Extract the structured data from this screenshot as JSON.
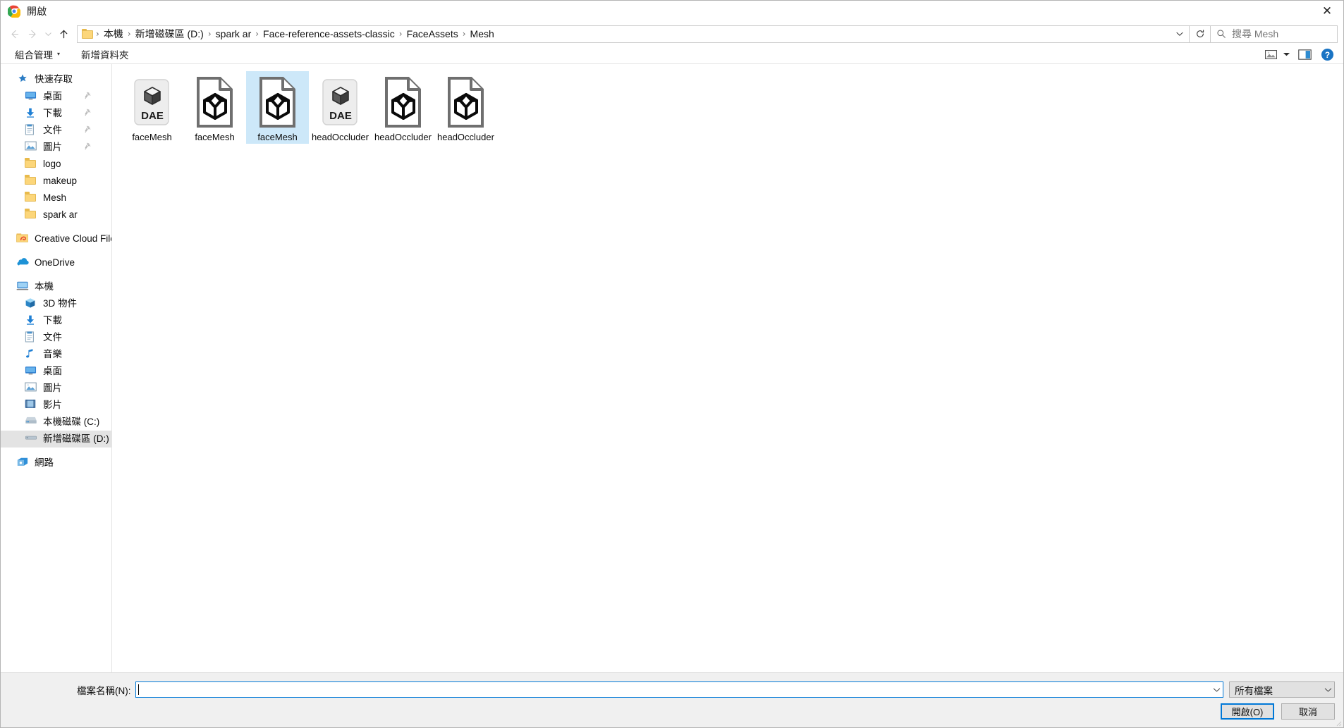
{
  "titlebar": {
    "app_icon": "chrome-icon",
    "title": "開啟",
    "close_label": "✕"
  },
  "navbar": {
    "back_icon": "arrow-left-icon",
    "forward_icon": "arrow-right-icon",
    "recent_icon": "chevron-down-icon",
    "up_icon": "arrow-up-icon",
    "breadcrumb": [
      "本機",
      "新增磁碟區 (D:)",
      "spark ar",
      "Face-reference-assets-classic",
      "FaceAssets",
      "Mesh"
    ],
    "separator": "›",
    "address_dropdown_icon": "chevron-down-icon",
    "refresh_icon": "refresh-icon",
    "search": {
      "icon": "search-icon",
      "placeholder": "搜尋 Mesh",
      "value": ""
    }
  },
  "toolbar": {
    "organize_label": "組合管理",
    "organize_caret": "▾",
    "new_folder_label": "新增資料夾",
    "view_icon": "view-layout-icon",
    "view_caret": "▾",
    "preview_pane_icon": "preview-pane-icon",
    "help_icon": "help-icon"
  },
  "sidebar": {
    "groups": [
      {
        "name": "quick-access",
        "header": {
          "label": "快速存取",
          "icon": "star-pin-icon"
        },
        "items": [
          {
            "label": "桌面",
            "icon": "desktop-icon",
            "pinned": true
          },
          {
            "label": "下載",
            "icon": "downloads-icon",
            "pinned": true
          },
          {
            "label": "文件",
            "icon": "documents-icon",
            "pinned": true
          },
          {
            "label": "圖片",
            "icon": "pictures-icon",
            "pinned": true
          },
          {
            "label": "logo",
            "icon": "folder-icon",
            "pinned": false
          },
          {
            "label": "makeup",
            "icon": "folder-icon",
            "pinned": false
          },
          {
            "label": "Mesh",
            "icon": "folder-icon",
            "pinned": false
          },
          {
            "label": "spark ar",
            "icon": "folder-icon",
            "pinned": false
          }
        ]
      },
      {
        "name": "creative-cloud",
        "header": {
          "label": "Creative Cloud Files",
          "icon": "creative-cloud-icon"
        },
        "items": []
      },
      {
        "name": "onedrive",
        "header": {
          "label": "OneDrive",
          "icon": "onedrive-icon"
        },
        "items": []
      },
      {
        "name": "this-pc",
        "header": {
          "label": "本機",
          "icon": "this-pc-icon"
        },
        "items": [
          {
            "label": "3D 物件",
            "icon": "3d-objects-icon",
            "pinned": false
          },
          {
            "label": "下載",
            "icon": "downloads-icon",
            "pinned": false
          },
          {
            "label": "文件",
            "icon": "documents-icon",
            "pinned": false
          },
          {
            "label": "音樂",
            "icon": "music-icon",
            "pinned": false
          },
          {
            "label": "桌面",
            "icon": "desktop-icon",
            "pinned": false
          },
          {
            "label": "圖片",
            "icon": "pictures-icon",
            "pinned": false
          },
          {
            "label": "影片",
            "icon": "videos-icon",
            "pinned": false
          },
          {
            "label": "本機磁碟 (C:)",
            "icon": "hard-drive-icon",
            "pinned": false
          },
          {
            "label": "新增磁碟區 (D:)",
            "icon": "drive-icon",
            "pinned": false,
            "selected": true
          }
        ]
      },
      {
        "name": "network",
        "header": {
          "label": "網路",
          "icon": "network-icon"
        },
        "items": []
      }
    ]
  },
  "files": [
    {
      "label": "faceMesh",
      "icon": "dae-file-icon",
      "selected": false
    },
    {
      "label": "faceMesh",
      "icon": "mesh-file-icon",
      "selected": false
    },
    {
      "label": "faceMesh",
      "icon": "mesh-file-icon",
      "selected": true
    },
    {
      "label": "headOccluder",
      "icon": "dae-file-icon",
      "selected": false
    },
    {
      "label": "headOccluder",
      "icon": "mesh-file-icon",
      "selected": false
    },
    {
      "label": "headOccluder",
      "icon": "mesh-file-icon",
      "selected": false
    }
  ],
  "icon_text": {
    "dae": "DAE"
  },
  "footer": {
    "filename_label": "檔案名稱(N):",
    "filename_value": "",
    "filename_dropdown_icon": "chevron-down-icon",
    "filetype_value": "所有檔案",
    "filetype_dropdown_icon": "chevron-down-icon",
    "open_button": "開啟(O)",
    "cancel_button": "取消"
  },
  "colors": {
    "accent": "#0078d7",
    "selection": "#cde8f9",
    "sidebar_selection": "#e3e3e3",
    "folder": "#fcd67a",
    "footer_bg": "#f0f0f0"
  }
}
